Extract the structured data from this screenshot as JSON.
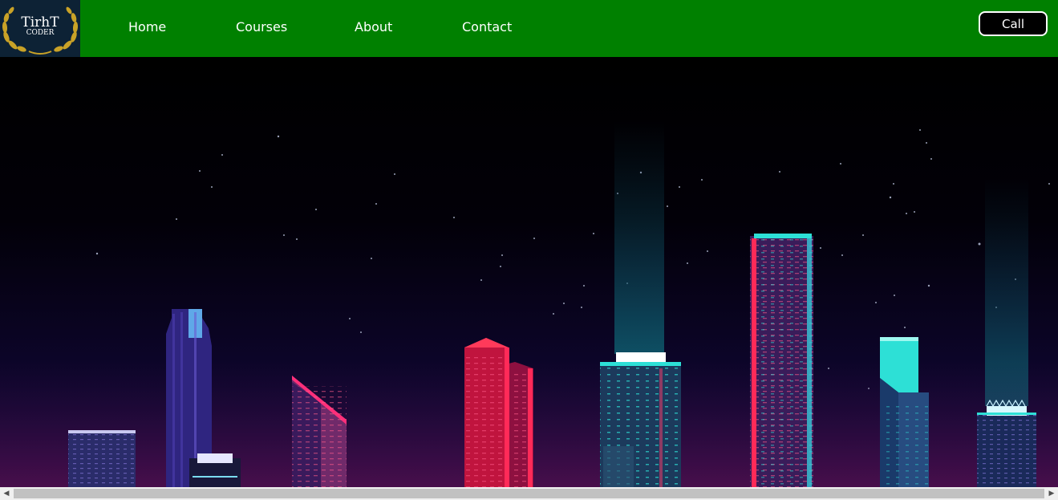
{
  "brand": {
    "logo_line1": "TirhT",
    "logo_line2": "CODER",
    "color_navbar": "#008000",
    "color_logo_bg": "#0d2235",
    "color_logo_wreath": "#c9a227"
  },
  "nav": {
    "items": [
      {
        "label": "Home"
      },
      {
        "label": "Courses"
      },
      {
        "label": "About"
      },
      {
        "label": "Contact"
      }
    ],
    "call_label": "Call"
  },
  "hero": {
    "image": "night-city-skyline-illustration"
  },
  "scrollbar": {
    "left_arrow": "◀",
    "right_arrow": "▶"
  }
}
